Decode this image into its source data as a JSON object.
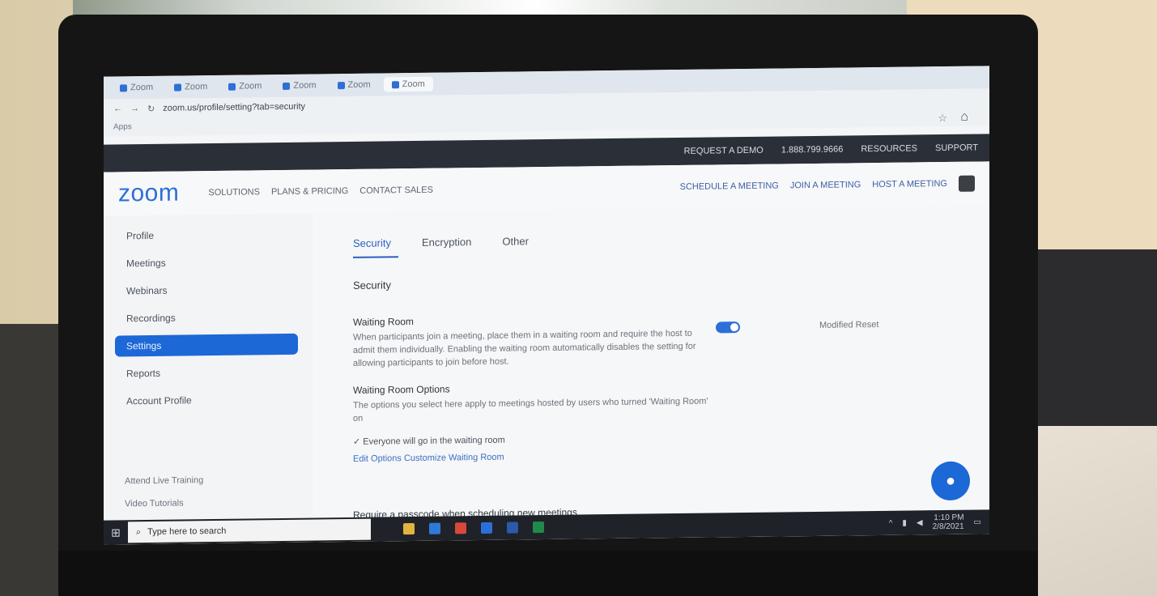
{
  "browser": {
    "tabs": [
      {
        "label": "Zoom",
        "active": false
      },
      {
        "label": "Zoom",
        "active": false
      },
      {
        "label": "Zoom",
        "active": false
      },
      {
        "label": "Zoom",
        "active": false
      },
      {
        "label": "Zoom",
        "active": false
      },
      {
        "label": "Zoom",
        "active": true
      }
    ],
    "url": "zoom.us/profile/setting?tab=security",
    "bookmarks_label": "Apps"
  },
  "zoom": {
    "topbar": [
      "REQUEST A DEMO",
      "1.888.799.9666",
      "RESOURCES",
      "SUPPORT"
    ],
    "logo": "zoom",
    "nav": [
      "SOLUTIONS",
      "PLANS & PRICING",
      "CONTACT SALES"
    ],
    "nav_right": [
      "SCHEDULE A MEETING",
      "JOIN A MEETING",
      "HOST A MEETING"
    ],
    "sidebar": {
      "items": [
        "Profile",
        "Meetings",
        "Webinars",
        "Recordings",
        "Settings",
        "Reports",
        "Account Profile"
      ],
      "active_index": 4,
      "bottom": [
        "Attend Live Training",
        "Video Tutorials"
      ]
    },
    "main": {
      "tabs": [
        "Security",
        "Encryption",
        "Other"
      ],
      "active_tab": 0,
      "section_title": "Security",
      "setting1_title": "Waiting Room",
      "setting1_desc": "When participants join a meeting, place them in a waiting room and require the host to admit them individually. Enabling the waiting room automatically disables the setting for allowing participants to join before host.",
      "setting1_modified": "Modified  Reset",
      "setting2_title": "Waiting Room Options",
      "setting2_desc": "The options you select here apply to meetings hosted by users who turned 'Waiting Room' on",
      "check_label": "Everyone will go in the waiting room",
      "link_label": "Edit Options   Customize Waiting Room",
      "bottom_cut": "Require a passcode when scheduling new meetings"
    }
  },
  "taskbar": {
    "search_placeholder": "Type here to search",
    "time": "1:10 PM",
    "date": "2/8/2021"
  },
  "colors": {
    "zoom_blue": "#2d6fd8",
    "sidebar_active": "#1c68d6",
    "topbar": "#2b2f37",
    "taskbar": "#1f2228"
  }
}
